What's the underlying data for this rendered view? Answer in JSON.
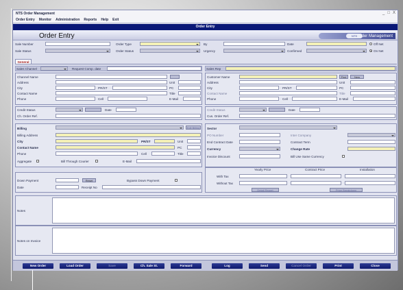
{
  "window": {
    "title": "NTS Order Management",
    "controls": [
      "_",
      "□",
      "X"
    ]
  },
  "menu": [
    "Order Entry",
    "Monitor",
    "Administration",
    "Reports",
    "Help",
    "Exit"
  ],
  "form_bar": "Order Entry",
  "header": {
    "title": "Order Entry",
    "brand": "Order Management",
    "brand_badge": "NTS"
  },
  "top": {
    "sale_number": "Sale Number",
    "order_type": "Order Type",
    "by": "By",
    "date": "Date",
    "sale_status": "Sale Status",
    "order_status": "Order Status",
    "urgency": "Urgency",
    "confirmed": "Confirmed",
    "off_net": "Off Net",
    "on_net": "On Net"
  },
  "tab": "General",
  "left": {
    "sales_channel": "Sales Channel",
    "request_comp_date": "Request Comp. date",
    "channel_name": "Channel Name",
    "address": "Address",
    "unit": "Unit",
    "city": "City",
    "prst": "PR/ST",
    "pc": "PC",
    "contact_name": "Contact Name",
    "title": "Title",
    "phone": "Phone",
    "cell": "Cell",
    "email": "E-Mail",
    "credit_status": "Credit Status",
    "date": "Date",
    "ch_order_ref": "Ch. Order Ref.",
    "billing": "Billing",
    "billing_address": "Billing Address",
    "billing_btn": "Edit Billing",
    "aggregate": "Aggregate",
    "bill_through_courier": "Bill Through Courier",
    "down_payment": "Down Payment",
    "reset": "Reset",
    "bypass_down_payment": "Bypass Down Payment",
    "receipt_no": "Receipt No"
  },
  "right": {
    "sales_rep": "Sales Rep",
    "customer_name": "Customer Name",
    "find": "Find",
    "new": "New",
    "address": "Address",
    "unit": "Unit",
    "city": "City",
    "prst": "PR/ST",
    "pc": "PC",
    "contact_name": "Contact Name",
    "title": "Title",
    "phone": "Phone",
    "cell": "Cell",
    "email": "E-Mail",
    "credit_status": "Credit Status",
    "date": "Date",
    "cus_order_ref": "Cus. Order Ref.",
    "sector": "Sector",
    "po_number": "PO Number",
    "inter_company": "Inter Company",
    "end_contract_date": "End Contract Date",
    "contract_term": "Contract Term",
    "currency": "Currency",
    "change_rate": "Change Rate",
    "invoice_discount": "Invoice Discount",
    "bill_use_same_currency": "Bill Use Same Currency",
    "yearly_price": "Yearly Price",
    "contract_price": "Contract Price",
    "installation": "Installation",
    "with_tax": "With Tax",
    "without_tax": "Without Tax",
    "detail_report": "Detail Report",
    "price_breakdown": "Price Breakdown"
  },
  "notes": {
    "notes": "Notes",
    "notes_on_invoice": "Notes on Invoice"
  },
  "buttons": [
    {
      "label": "New Order",
      "enabled": true
    },
    {
      "label": "Load Order",
      "enabled": true
    },
    {
      "label": "Save",
      "enabled": false
    },
    {
      "label": "Ch. Sale St.",
      "enabled": true
    },
    {
      "label": "Forward",
      "enabled": true
    },
    {
      "label": "Log",
      "enabled": true
    },
    {
      "label": "Send",
      "enabled": true
    },
    {
      "label": "Cancel Order",
      "enabled": false
    },
    {
      "label": "Print",
      "enabled": true
    },
    {
      "label": "Close",
      "enabled": true
    }
  ],
  "colors": {
    "title_bar": "#0a1877",
    "required_field": "#f4f1b7",
    "button": "#0e1a6e"
  }
}
